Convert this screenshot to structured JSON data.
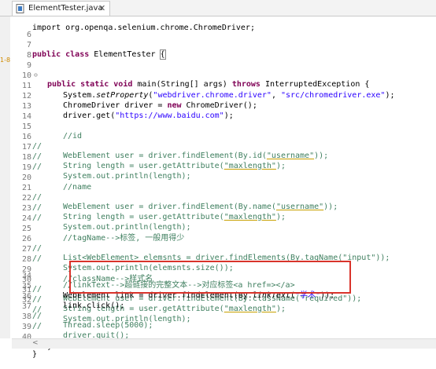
{
  "tab": {
    "title": "ElementTester.java",
    "close": "✕"
  },
  "gutter_mark": "1-8",
  "partial_top_line": "import org.openqa.selenium.chrome.ChromeDriver;",
  "lines": [
    {
      "n": "6",
      "c": ""
    },
    {
      "n": "7",
      "c": "public class ElementTester {"
    },
    {
      "n": "8",
      "c": ""
    },
    {
      "n": "9",
      "c": "public static void main(String[] args) throws InterruptedException {"
    },
    {
      "n": "10",
      "c": ""
    },
    {
      "n": "11",
      "c": "System.setProperty(\"webdriver.chrome.driver\", \"src/chromedriver.exe\");"
    },
    {
      "n": "12",
      "c": "ChromeDriver driver = new ChromeDriver();"
    },
    {
      "n": "13",
      "c": "driver.get(\"https://www.baidu.com\");"
    },
    {
      "n": "14",
      "c": ""
    },
    {
      "n": "15",
      "c": "//id"
    },
    {
      "n": "16",
      "c": "WebElement user = driver.findElement(By.id(\"username\"));"
    },
    {
      "n": "17",
      "c": "String length = user.getAttribute(\"maxlength\");"
    },
    {
      "n": "18",
      "c": "System.out.println(length);"
    },
    {
      "n": "19",
      "c": ""
    },
    {
      "n": "20",
      "c": "//name"
    },
    {
      "n": "21",
      "c": "WebElement user = driver.findElement(By.name(\"username\"));"
    },
    {
      "n": "22",
      "c": "String length = user.getAttribute(\"maxlength\");"
    },
    {
      "n": "23",
      "c": "System.out.println(length);"
    },
    {
      "n": "24",
      "c": ""
    },
    {
      "n": "25",
      "c": "//tagName-->标签, 一般用得少"
    },
    {
      "n": "26",
      "c": "List<WebElement> elemsnts = driver.findElements(By.tagName(\"input\"));"
    },
    {
      "n": "27",
      "c": "System.out.println(elemsnts.size());"
    },
    {
      "n": "28",
      "c": ""
    },
    {
      "n": "29",
      "c": "//className-->样式名"
    },
    {
      "n": "30",
      "c": "WebElement user = driver.findElement(By.className(\"required\"));"
    },
    {
      "n": "31",
      "c": "String length = user.getAttribute(\"maxlength\");"
    },
    {
      "n": "32",
      "c": "System.out.println(length);"
    },
    {
      "n": "33",
      "c": ""
    },
    {
      "n": "34",
      "c": "//linkText-->超链接的完整文本-->对应标签<a href=></a>"
    },
    {
      "n": "35",
      "c": "WebElement link = driver.findElement(By.linkText(\"学术\"));"
    },
    {
      "n": "36",
      "c": "link.click();"
    },
    {
      "n": "37",
      "c": "Thread.sleep(5000);"
    },
    {
      "n": "38",
      "c": "driver.quit();"
    },
    {
      "n": "39",
      "c": ""
    },
    {
      "n": "40",
      "c": "}"
    },
    {
      "n": "41",
      "c": "}"
    }
  ],
  "comment_marker": "//",
  "scroll_arrow": "<"
}
